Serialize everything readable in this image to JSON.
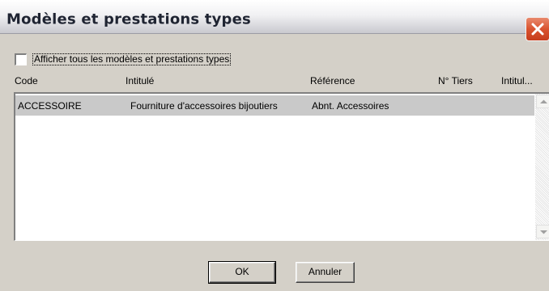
{
  "window": {
    "title": "Modèles et prestations types",
    "close_icon": "close-icon",
    "close_color": "#d9532f"
  },
  "filter": {
    "show_all_label": "Afficher tous les modèles et prestations types",
    "show_all_checked": false
  },
  "table": {
    "columns": [
      "Code",
      "Intitulé",
      "Référence",
      "N° Tiers",
      "Intitul..."
    ],
    "rows": [
      {
        "code": "ACCESSOIRE",
        "intitule": "Fourniture d'accessoires bijoutiers",
        "reference": "Abnt. Accessoires",
        "tiers": "",
        "intitule2": ""
      }
    ],
    "selected_row_color": "#c9c9c9"
  },
  "buttons": {
    "ok": "OK",
    "cancel": "Annuler"
  }
}
